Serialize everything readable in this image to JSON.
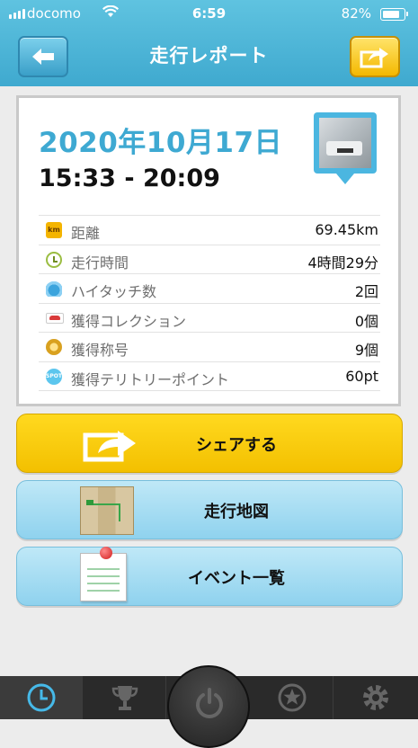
{
  "status_bar": {
    "carrier": "docomo",
    "time": "6:59",
    "battery": "82%"
  },
  "nav": {
    "title": "走行レポート",
    "back_icon": "arrow-left-icon",
    "share_icon": "share-arrow-icon"
  },
  "report": {
    "date": "2020年10月17日",
    "time_range": "15:33 - 20:09",
    "rows": [
      {
        "icon": "km-icon",
        "icon_text": "km",
        "label": "距離",
        "value": "69.45km"
      },
      {
        "icon": "clock-icon",
        "label": "走行時間",
        "value": "4時間29分"
      },
      {
        "icon": "high-five-icon",
        "label": "ハイタッチ数",
        "value": "2回"
      },
      {
        "icon": "car-icon",
        "label": "獲得コレクション",
        "value": "0個"
      },
      {
        "icon": "medal-icon",
        "label": "獲得称号",
        "value": "9個"
      },
      {
        "icon": "spot-icon",
        "icon_text": "SPOT",
        "label": "獲得テリトリーポイント",
        "value": "60pt"
      }
    ]
  },
  "actions": {
    "share_label": "シェアする",
    "map_label": "走行地図",
    "events_label": "イベント一覧"
  },
  "tabbar": {
    "items": [
      "history-clock-icon",
      "trophy-icon",
      "power-icon",
      "star-icon",
      "gear-icon"
    ]
  },
  "colors": {
    "header": "#4fb6da",
    "accent_blue": "#3ea9d2",
    "share_yellow": "#ffd200",
    "light_blue_button": "#a6dcf2"
  }
}
